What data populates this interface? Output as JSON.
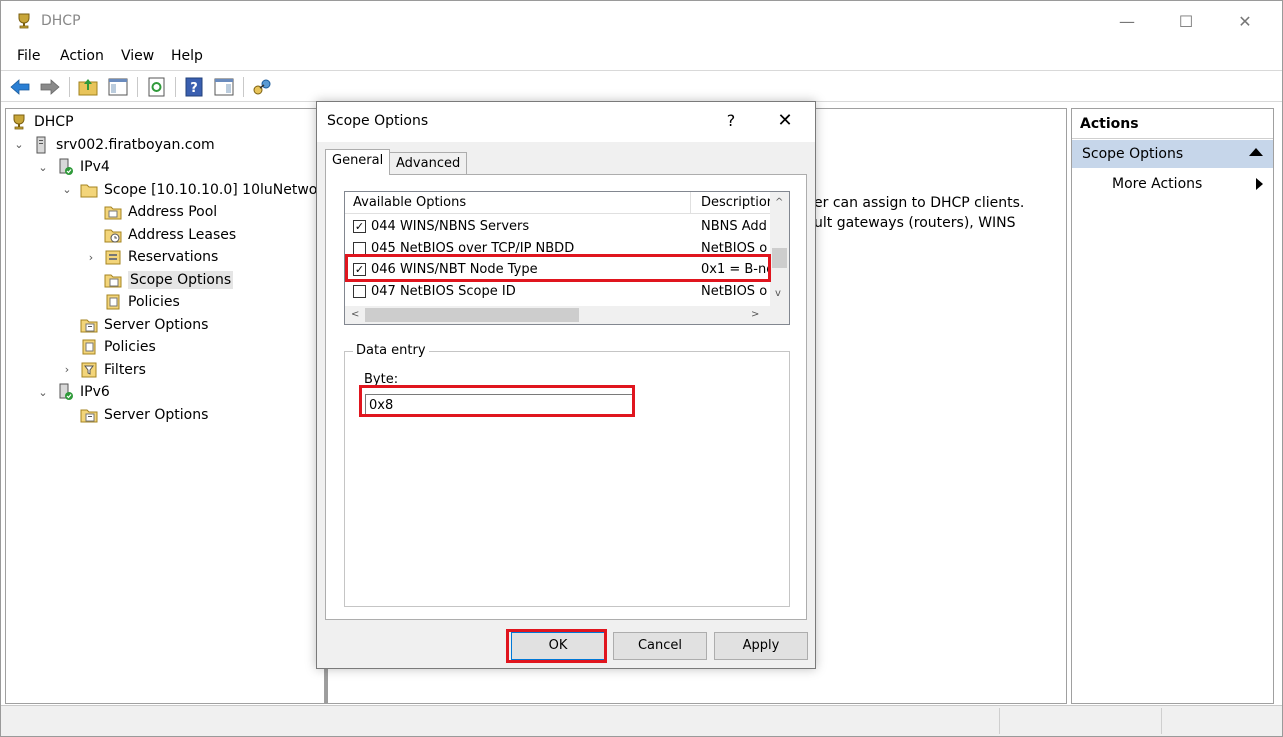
{
  "window": {
    "title": "DHCP"
  },
  "menu": [
    "File",
    "Action",
    "View",
    "Help"
  ],
  "tree": [
    {
      "label": "DHCP",
      "icon": "dhcp-icon",
      "level": 0,
      "expander": ""
    },
    {
      "label": "srv002.firatboyan.com",
      "icon": "server-icon",
      "level": 1,
      "expander": "⌄"
    },
    {
      "label": "IPv4",
      "icon": "ipv4-icon",
      "level": 2,
      "expander": "⌄"
    },
    {
      "label": "Scope [10.10.10.0] 10luNetwork",
      "icon": "folder-icon",
      "level": 3,
      "expander": "⌄"
    },
    {
      "label": "Address Pool",
      "icon": "address-pool-icon",
      "level": 4,
      "expander": ""
    },
    {
      "label": "Address Leases",
      "icon": "address-leases-icon",
      "level": 4,
      "expander": ""
    },
    {
      "label": "Reservations",
      "icon": "reservations-icon",
      "level": 4,
      "expander": "›"
    },
    {
      "label": "Scope Options",
      "icon": "scope-options-icon",
      "level": 4,
      "expander": "",
      "selected": true
    },
    {
      "label": "Policies",
      "icon": "policies-icon",
      "level": 4,
      "expander": ""
    },
    {
      "label": "Server Options",
      "icon": "server-options-icon",
      "level": 3,
      "expander": ""
    },
    {
      "label": "Policies",
      "icon": "policies-icon",
      "level": 3,
      "expander": ""
    },
    {
      "label": "Filters",
      "icon": "filters-icon",
      "level": 3,
      "expander": "›"
    },
    {
      "label": "IPv6",
      "icon": "ipv6-icon",
      "level": 2,
      "expander": "⌄"
    },
    {
      "label": "Server Options",
      "icon": "server-options-icon",
      "level": 3,
      "expander": ""
    }
  ],
  "center": {
    "line1": "er can assign to DHCP clients.",
    "line2": "ult gateways (routers), WINS"
  },
  "actions": {
    "header": "Actions",
    "section": "Scope Options",
    "more": "More Actions"
  },
  "dialog": {
    "title": "Scope Options",
    "help": "?",
    "close": "✕",
    "tabs": [
      "General",
      "Advanced"
    ],
    "list_headers": [
      "Available Options",
      "Descriptior"
    ],
    "options": [
      {
        "name": "044 WINS/NBNS Servers",
        "desc": "NBNS Add",
        "checked": true
      },
      {
        "name": "045 NetBIOS over TCP/IP NBDD",
        "desc": "NetBIOS o",
        "checked": false
      },
      {
        "name": "046 WINS/NBT Node Type",
        "desc": "0x1 = B-no",
        "checked": true
      },
      {
        "name": "047 NetBIOS Scope ID",
        "desc": "NetBIOS o",
        "checked": false
      }
    ],
    "group_label": "Data entry",
    "field_label": "Byte:",
    "field_value": "0x8",
    "buttons": {
      "ok": "OK",
      "cancel": "Cancel",
      "apply": "Apply"
    }
  },
  "colors": {
    "highlight": "#e0151e",
    "accent": "#0078d7",
    "action_section_bg": "#c6d6ea"
  }
}
